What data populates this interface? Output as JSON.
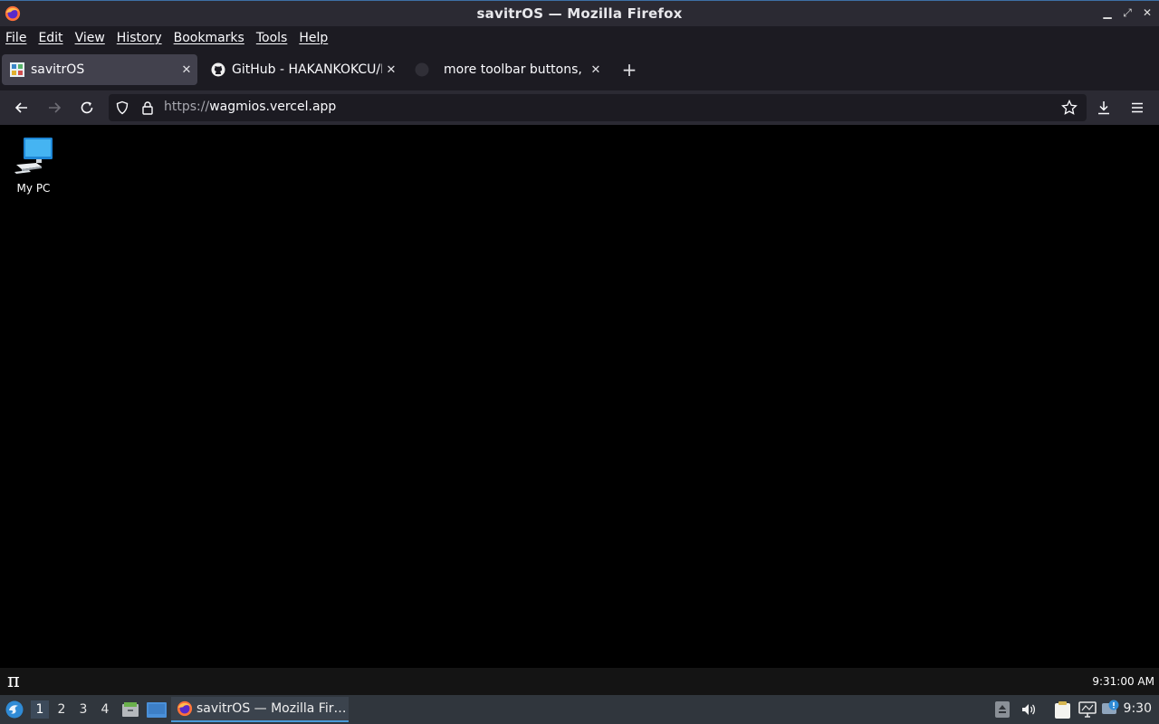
{
  "window": {
    "title": "savitrOS — Mozilla Firefox",
    "controls": {
      "minimize": "▁",
      "restore": "⤢",
      "close": "✕"
    }
  },
  "menubar": {
    "items": [
      "File",
      "Edit",
      "View",
      "History",
      "Bookmarks",
      "Tools",
      "Help"
    ]
  },
  "tabs": [
    {
      "label": "savitrOS",
      "favicon": "savitros-favicon",
      "active": true
    },
    {
      "label": "GitHub - HAKANKOKCU/B",
      "favicon": "github-icon",
      "active": false
    },
    {
      "label": "more toolbar buttons, ed",
      "favicon": "github-icon",
      "active": false
    }
  ],
  "new_tab_label": "+",
  "close_glyph": "✕",
  "navbar": {
    "url_protocol": "https://",
    "url_host": "wagmios.vercel.app"
  },
  "desktop": {
    "icons": [
      {
        "label": "My PC",
        "icon": "computer-icon"
      }
    ]
  },
  "webos_bar": {
    "logo": "π",
    "clock": "9:31:00 AM"
  },
  "panel": {
    "workspaces": [
      "1",
      "2",
      "3",
      "4"
    ],
    "active_workspace": "1",
    "task_label": "savitrOS — Mozilla Fir…",
    "time": "9:30"
  },
  "colors": {
    "accent": "#4a9ad8",
    "firefox_chrome": "#1c1b22",
    "toolbar": "#2b2a33",
    "active_tab": "#42414d",
    "panel": "#30363d"
  }
}
